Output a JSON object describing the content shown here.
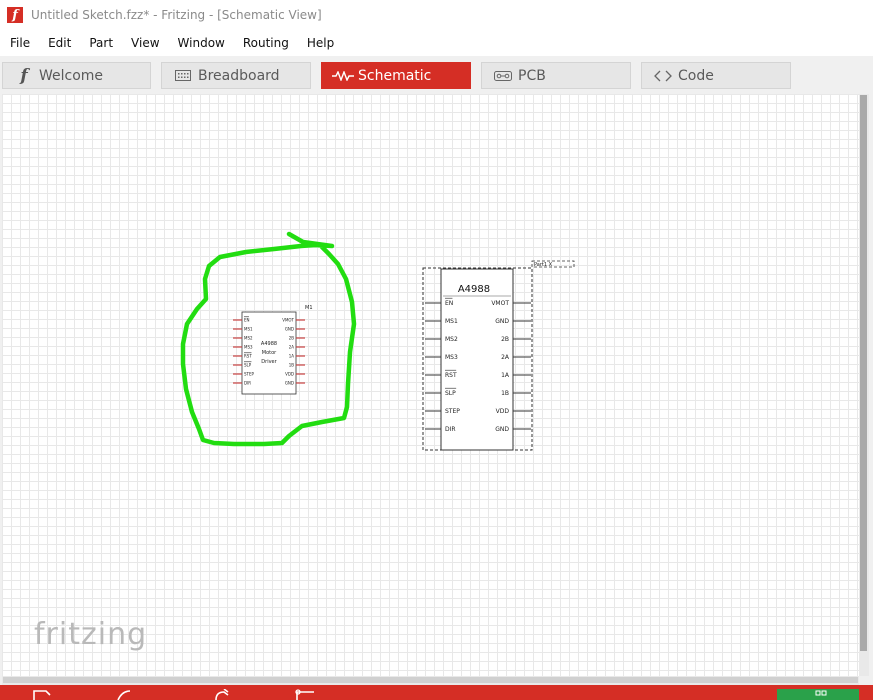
{
  "window": {
    "title": "Untitled Sketch.fzz* - Fritzing - [Schematic View]"
  },
  "menu": [
    "File",
    "Edit",
    "Part",
    "View",
    "Window",
    "Routing",
    "Help"
  ],
  "tabs": {
    "welcome": "Welcome",
    "breadboard": "Breadboard",
    "schematic": "Schematic",
    "pcb": "PCB",
    "code": "Code"
  },
  "canvas": {
    "watermark": "fritzing",
    "small_part": {
      "ref": "M1",
      "title_lines": [
        "A4988",
        "Motor",
        "Driver"
      ],
      "left_pins": [
        "EN",
        "MS1",
        "MS2",
        "MS3",
        "RST",
        "SLP",
        "STEP",
        "DIR"
      ],
      "right_pins": [
        "VMOT",
        "GND",
        "2B",
        "2A",
        "1A",
        "1B",
        "VDD",
        "GND"
      ]
    },
    "large_part": {
      "ref": "Part1 X",
      "title": "A4988",
      "left_pins": [
        "EN",
        "MS1",
        "MS2",
        "MS3",
        "RST",
        "SLP",
        "STEP",
        "DIR"
      ],
      "right_pins": [
        "VMOT",
        "GND",
        "2B",
        "2A",
        "1A",
        "1B",
        "VDD",
        "GND"
      ]
    }
  },
  "colors": {
    "accent": "#d52e25",
    "annotation": "#22dd11",
    "pin_red": "#c84040"
  }
}
